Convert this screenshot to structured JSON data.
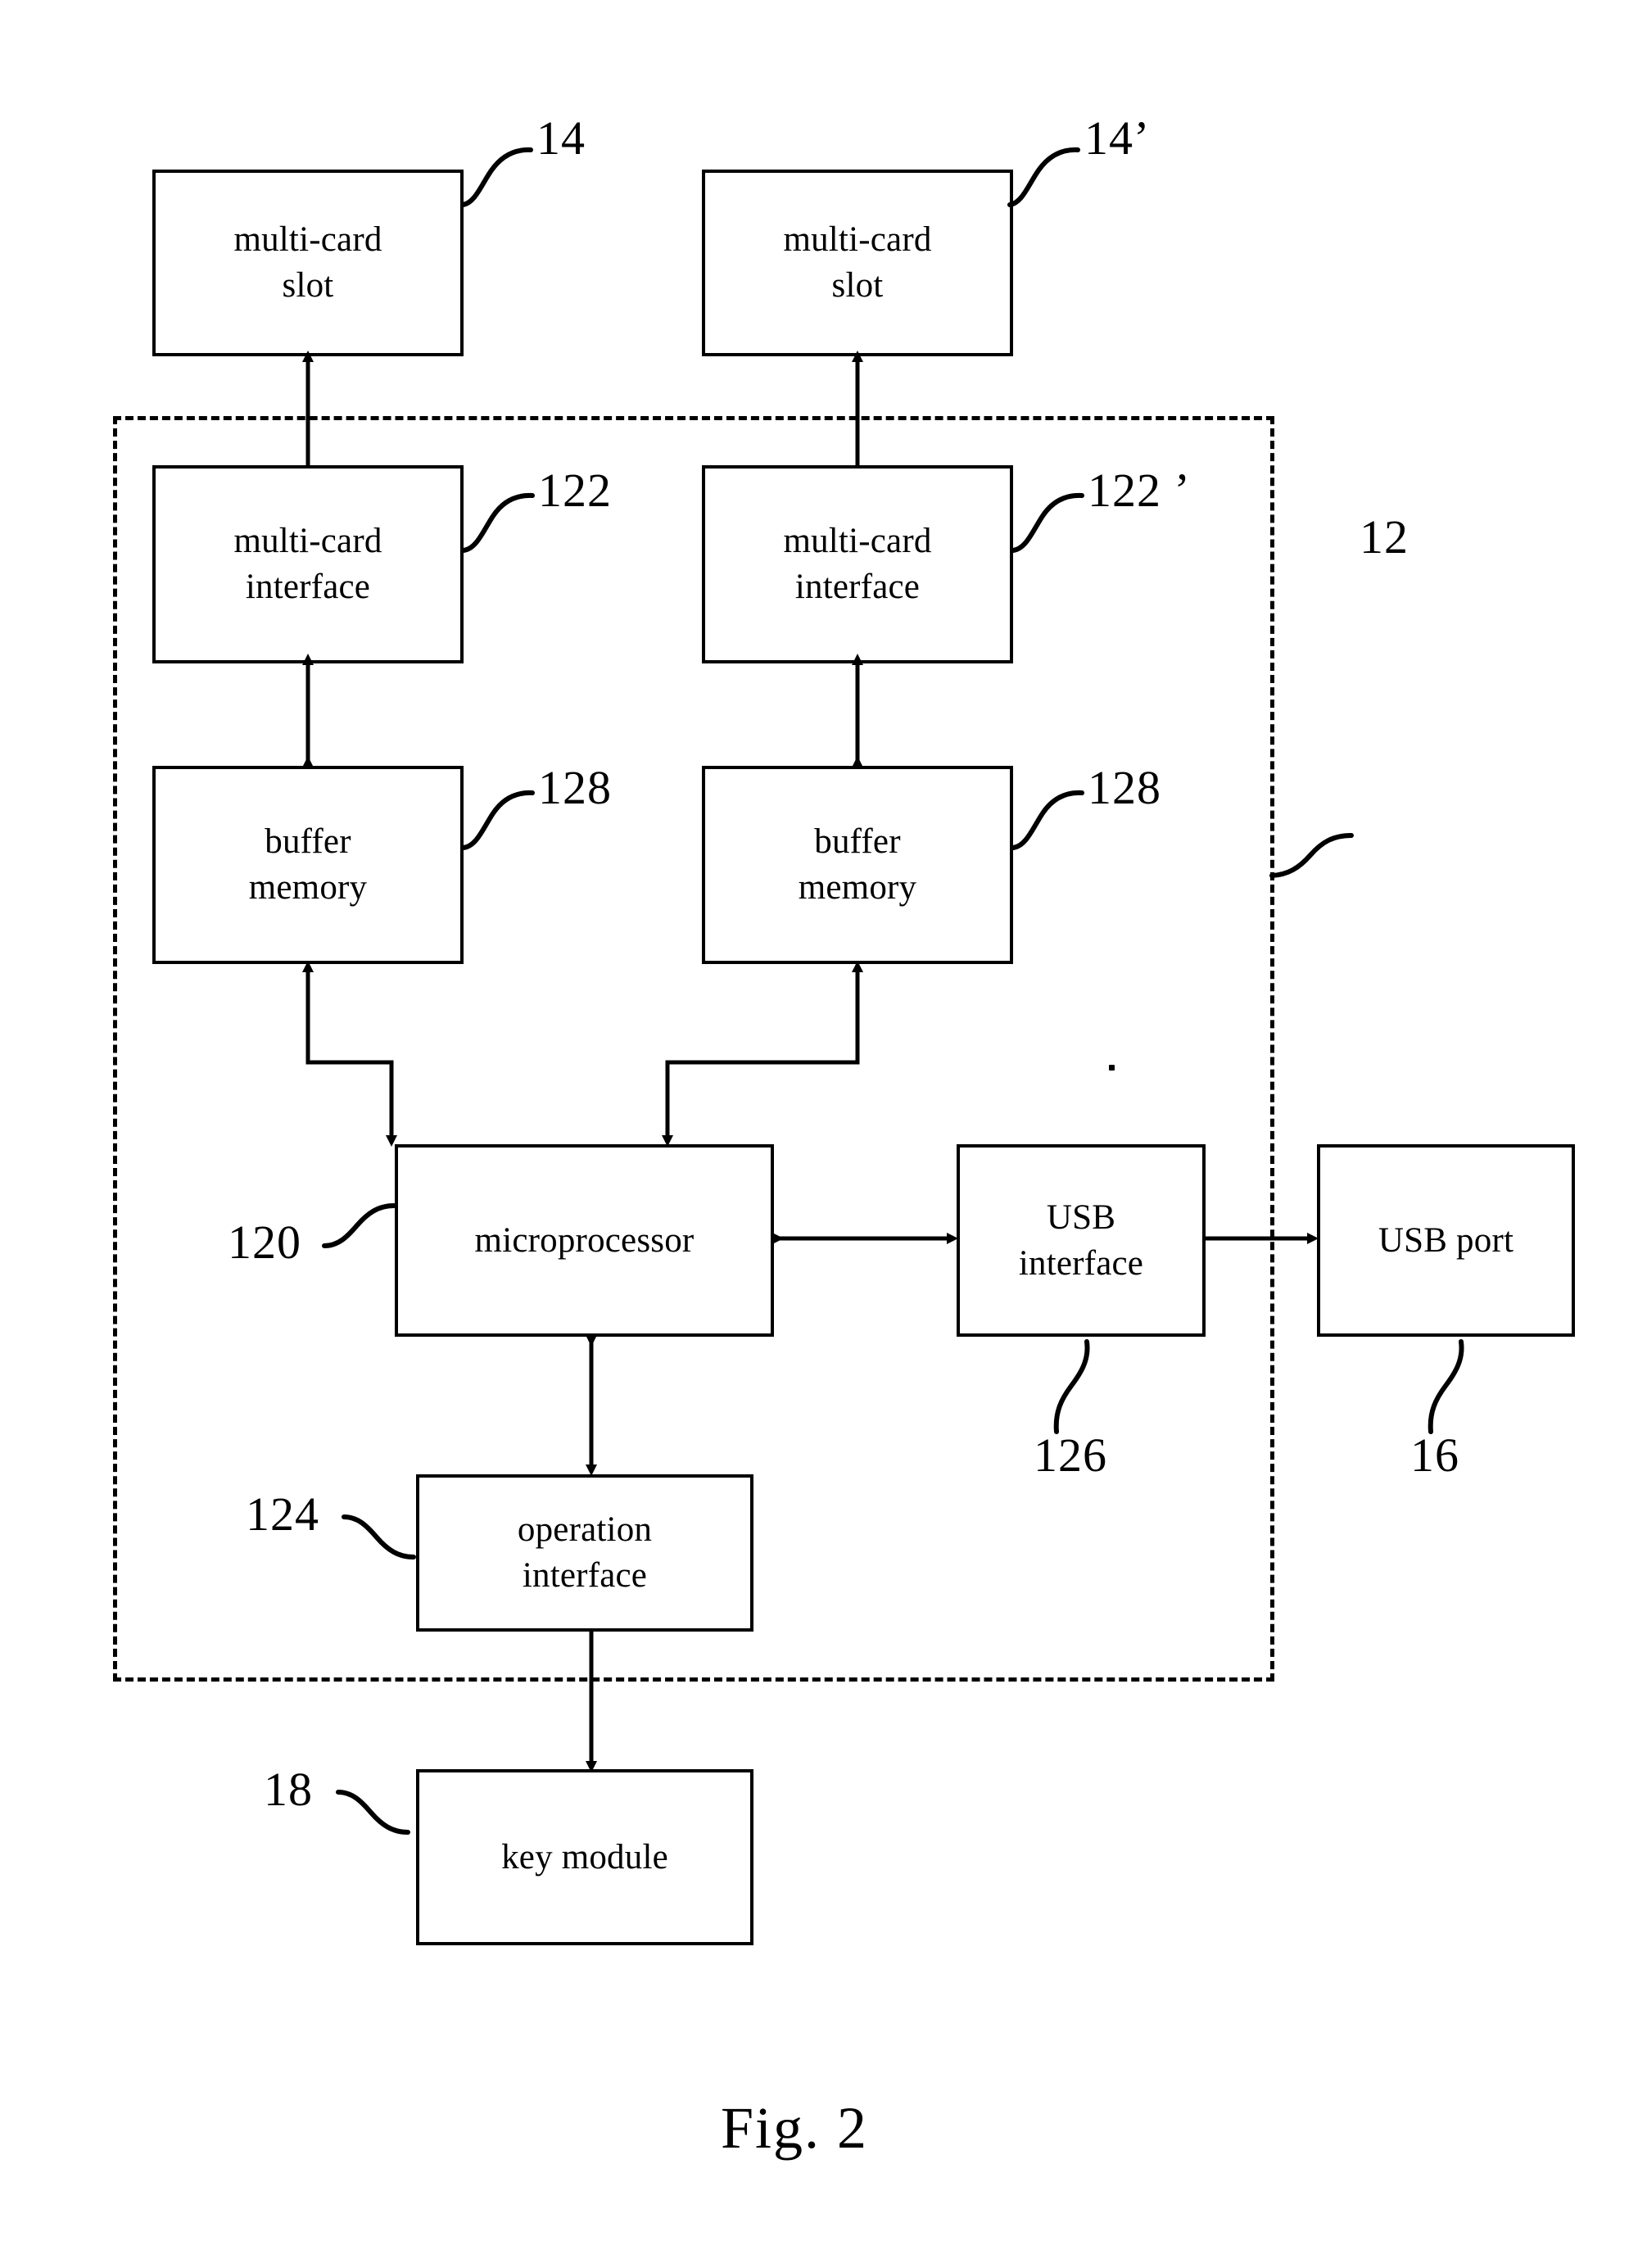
{
  "figure": {
    "caption": "Fig. 2",
    "blocks": [
      {
        "id": "multi-card-slot-left",
        "lines": [
          "multi-card",
          "slot"
        ]
      },
      {
        "id": "multi-card-slot-right",
        "lines": [
          "multi-card",
          "slot"
        ]
      },
      {
        "id": "multi-card-interface-left",
        "lines": [
          "multi-card",
          "interface"
        ]
      },
      {
        "id": "multi-card-interface-right",
        "lines": [
          "multi-card",
          "interface"
        ]
      },
      {
        "id": "buffer-memory-left",
        "lines": [
          "buffer",
          "memory"
        ]
      },
      {
        "id": "buffer-memory-right",
        "lines": [
          "buffer",
          "memory"
        ]
      },
      {
        "id": "microprocessor",
        "lines": [
          "microprocessor"
        ]
      },
      {
        "id": "usb-interface",
        "lines": [
          "USB",
          "interface"
        ]
      },
      {
        "id": "usb-port",
        "lines": [
          "USB port"
        ]
      },
      {
        "id": "operation-interface",
        "lines": [
          "operation",
          "interface"
        ]
      },
      {
        "id": "key-module",
        "lines": [
          "key module"
        ]
      }
    ],
    "reference_numerals": {
      "multi_card_slot_left": "14",
      "multi_card_slot_right": "14’",
      "multi_card_interface_left": "122",
      "multi_card_interface_right": "122 ’",
      "buffer_memory_left": "128",
      "buffer_memory_right": "128",
      "microprocessor": "120",
      "usb_interface": "126",
      "usb_port": "16",
      "operation_interface": "124",
      "key_module": "18",
      "enclosure": "12"
    },
    "block_text": {
      "multi_card_slot_left_line1": "multi-card",
      "multi_card_slot_left_line2": "slot",
      "multi_card_slot_right_line1": "multi-card",
      "multi_card_slot_right_line2": "slot",
      "multi_card_interface_left_line1": "multi-card",
      "multi_card_interface_left_line2": "interface",
      "multi_card_interface_right_line1": "multi-card",
      "multi_card_interface_right_line2": "interface",
      "buffer_memory_left_line1": "buffer",
      "buffer_memory_left_line2": "memory",
      "buffer_memory_right_line1": "buffer",
      "buffer_memory_right_line2": "memory",
      "microprocessor_line1": "microprocessor",
      "usb_interface_line1": "USB",
      "usb_interface_line2": "interface",
      "usb_port_line1": "USB port",
      "operation_interface_line1": "operation",
      "operation_interface_line2": "interface",
      "key_module_line1": "key module"
    },
    "colors": {
      "ink": "#000000",
      "paper": "#ffffff"
    }
  }
}
